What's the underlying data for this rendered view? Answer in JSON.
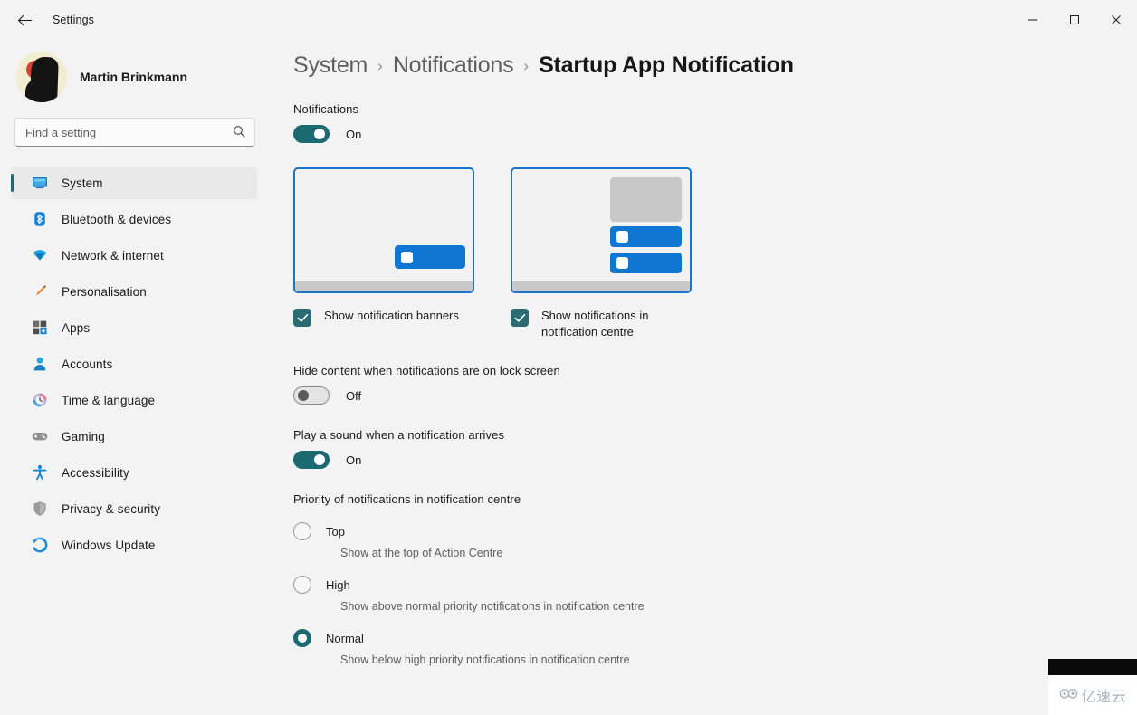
{
  "window": {
    "title": "Settings",
    "back_icon": "back-arrow-icon",
    "minimize_label": "—",
    "maximize_label": "□",
    "close_label": "✕"
  },
  "sidebar": {
    "profile": {
      "name": "Martin Brinkmann",
      "avatar_icon": "user-avatar"
    },
    "search": {
      "placeholder": "Find a setting",
      "value": "",
      "icon": "search-icon"
    },
    "items": [
      {
        "label": "System",
        "icon": "system-icon",
        "active": true
      },
      {
        "label": "Bluetooth & devices",
        "icon": "bluetooth-icon",
        "active": false
      },
      {
        "label": "Network & internet",
        "icon": "network-icon",
        "active": false
      },
      {
        "label": "Personalisation",
        "icon": "paintbrush-icon",
        "active": false
      },
      {
        "label": "Apps",
        "icon": "apps-icon",
        "active": false
      },
      {
        "label": "Accounts",
        "icon": "accounts-icon",
        "active": false
      },
      {
        "label": "Time & language",
        "icon": "clock-icon",
        "active": false
      },
      {
        "label": "Gaming",
        "icon": "gamepad-icon",
        "active": false
      },
      {
        "label": "Accessibility",
        "icon": "accessibility-icon",
        "active": false
      },
      {
        "label": "Privacy & security",
        "icon": "shield-icon",
        "active": false
      },
      {
        "label": "Windows Update",
        "icon": "update-icon",
        "active": false
      }
    ]
  },
  "breadcrumb": {
    "root": "System",
    "parent": "Notifications",
    "current": "Startup App Notification",
    "separator": "›"
  },
  "main": {
    "notifications": {
      "label": "Notifications",
      "toggle_state": "On",
      "toggle_on": true
    },
    "previews": [
      {
        "checkbox_label": "Show notification banners",
        "checked": true,
        "preview_name": "notification-banner-preview"
      },
      {
        "checkbox_label": "Show notifications in notification centre",
        "checked": true,
        "preview_name": "notification-centre-preview"
      }
    ],
    "hide_content": {
      "label": "Hide content when notifications are on lock screen",
      "toggle_state": "Off",
      "toggle_on": false
    },
    "play_sound": {
      "label": "Play a sound when a notification arrives",
      "toggle_state": "On",
      "toggle_on": true
    },
    "priority": {
      "label": "Priority of notifications in notification centre",
      "options": [
        {
          "label": "Top",
          "description": "Show at the top of Action Centre",
          "selected": false
        },
        {
          "label": "High",
          "description": "Show above normal priority notifications in notification centre",
          "selected": false
        },
        {
          "label": "Normal",
          "description": "Show below high priority notifications in notification centre",
          "selected": true
        }
      ]
    }
  },
  "watermark": {
    "text": "亿速云",
    "icon": "cloud-logo-icon"
  },
  "colors": {
    "accent_teal": "#1b6a72",
    "accent_blue": "#0f76d4",
    "card_border": "#1676c8",
    "background": "#f3f3f3"
  }
}
